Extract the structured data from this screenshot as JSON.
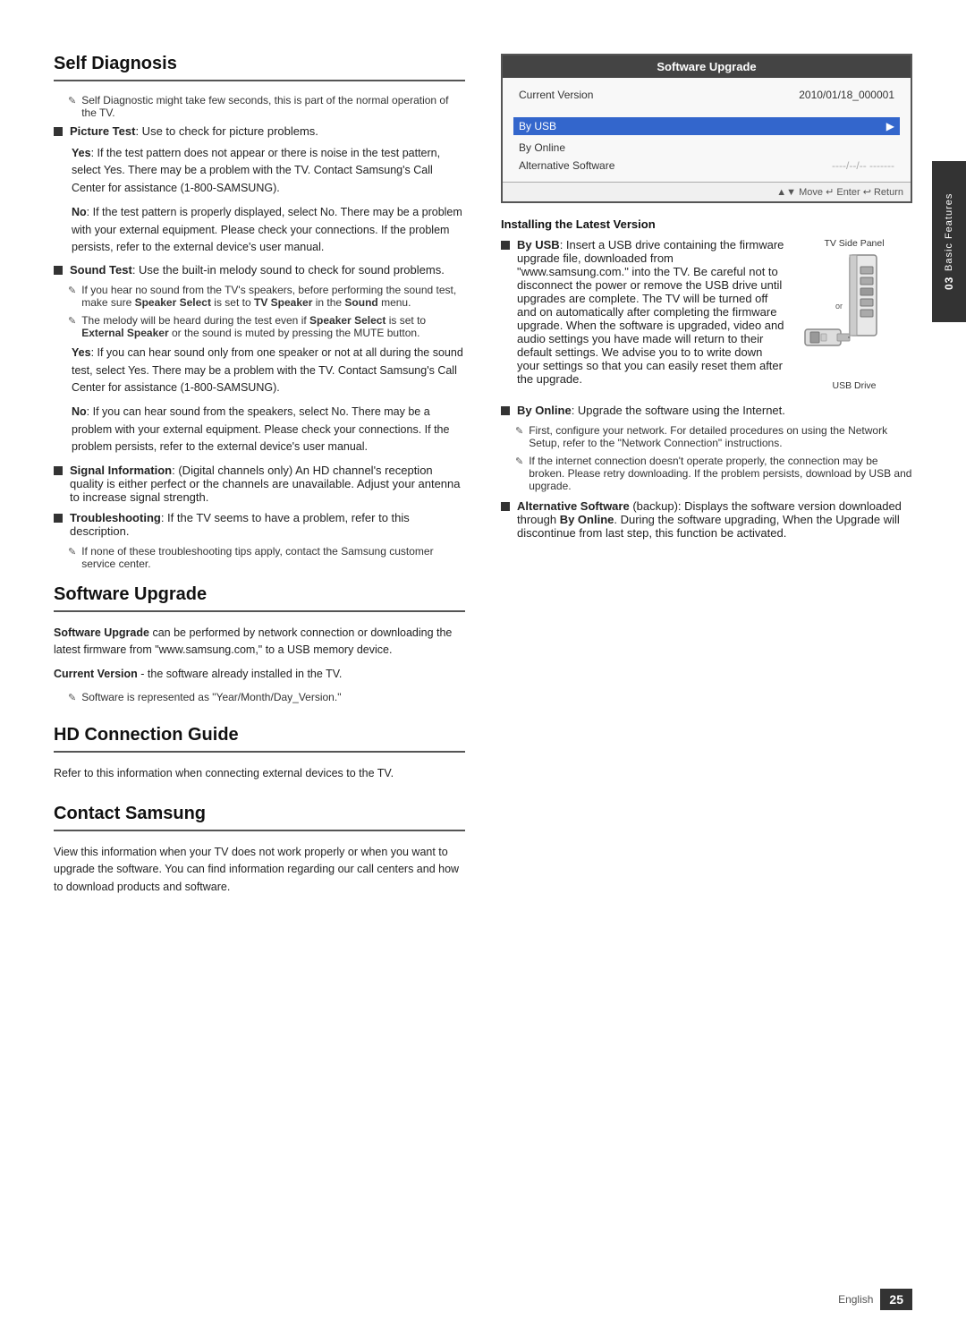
{
  "page": {
    "number": "25",
    "language": "English",
    "chapter": "03",
    "chapter_label": "Basic Features"
  },
  "self_diagnosis": {
    "title": "Self Diagnosis",
    "intro": "Self Diagnostic might take few seconds, this is part of the normal operation of the TV.",
    "bullets": [
      {
        "label": "Picture Test",
        "label_suffix": ": Use to check for picture problems.",
        "sub_items": [
          "Yes: If the test pattern does not appear or there is noise in the test pattern, select Yes. There may be a problem with the TV. Contact Samsung's Call Center for assistance (1-800-SAMSUNG).",
          "No: If the test pattern is properly displayed, select No. There may be a problem with your external equipment. Please check your connections. If the problem persists, refer to the external device's user manual."
        ]
      },
      {
        "label": "Sound Test",
        "label_suffix": ": Use the built-in melody sound to check for sound problems.",
        "sub_items": [
          "If you hear no sound from the TV's speakers, before performing the sound test, make sure Speaker Select is set to TV Speaker in the Sound menu.",
          "The melody will be heard during the test even if Speaker Select is set to External Speaker or the sound is muted by pressing the MUTE button."
        ],
        "yes_no": [
          "Yes: If you can hear sound only from one speaker or not at all during the sound test, select Yes. There may be a problem with the TV. Contact Samsung's Call Center for assistance (1-800-SAMSUNG).",
          "No: If you can hear sound from the speakers, select No. There may be a problem with your external equipment. Please check your connections. If the problem persists, refer to the external device's user manual."
        ]
      },
      {
        "label": "Signal Information",
        "label_suffix": ": (Digital channels only) An HD channel's reception quality is either perfect or the channels are unavailable. Adjust your antenna to increase signal strength."
      },
      {
        "label": "Troubleshooting",
        "label_suffix": ": If the TV seems to have a problem, refer to this description.",
        "sub_items": [
          "If none of these troubleshooting tips apply, contact the Samsung customer service center."
        ]
      }
    ]
  },
  "software_upgrade": {
    "title": "Software Upgrade",
    "intro": "Software Upgrade can be performed by network connection or downloading the latest firmware from \"www.samsung.com,\" to a USB memory device.",
    "current_version_label": "Current Version",
    "current_version_note": "- the software already installed in the TV.",
    "software_note": "Software is represented as \"Year/Month/Day_Version.\"",
    "box": {
      "header": "Software Upgrade",
      "current_version_key": "Current Version",
      "current_version_value": "2010/01/18_000001",
      "by_usb": "By USB",
      "by_online": "By Online",
      "alt_software": "Alternative Software",
      "alt_value": "----/--/-- -------",
      "footer": "▲▼ Move   ↵ Enter   ↩ Return"
    },
    "installing_title": "Installing the Latest Version",
    "by_usb_section": {
      "label": "By USB",
      "label_suffix": ": Insert a USB drive containing the firmware upgrade file, downloaded from \"www.samsung.com.\" into the TV. Be careful not to disconnect the power or remove the USB drive until upgrades are complete. The TV will be turned off and on automatically after completing the firmware upgrade. When the software is upgraded, video and audio settings you have made will return to their default settings. We advise you to to write down your settings so that you can easily reset them after the upgrade."
    },
    "tv_side_panel_label": "TV Side Panel",
    "usb_drive_label": "USB Drive",
    "by_online_section": {
      "label": "By Online",
      "label_suffix": ": Upgrade the software using the Internet.",
      "sub_items": [
        "First, configure your network. For detailed procedures on using the Network Setup, refer to the \"Network Connection\" instructions.",
        "If the internet connection doesn't operate properly, the connection may be broken. Please retry downloading. If the problem persists, download by USB and upgrade."
      ]
    },
    "alt_software_section": {
      "label": "Alternative Software",
      "label_suffix": " (backup): Displays the software version downloaded through By Online. During the software upgrading, When the Upgrade will discontinue from last step, this function be activated."
    }
  },
  "hd_connection": {
    "title": "HD Connection Guide",
    "text": "Refer to this information when connecting external devices to the TV."
  },
  "contact_samsung": {
    "title": "Contact Samsung",
    "text": "View this information when your TV does not work properly or when you want to upgrade the software. You can find information regarding our call centers and how to download products and software."
  }
}
